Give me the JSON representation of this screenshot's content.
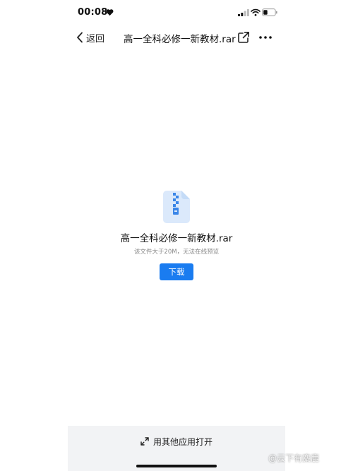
{
  "status_bar": {
    "time": "00:08",
    "icons": [
      "heart-icon",
      "signal-icon",
      "wifi-icon",
      "battery-icon"
    ]
  },
  "nav": {
    "back_label": "返回",
    "title": "高一全科必修一新教材.rar",
    "icons": [
      "chevron-left-icon",
      "share-icon",
      "more-icon"
    ]
  },
  "file": {
    "name": "高一全科必修一新教材.rar",
    "note": "该文件大于20M，无法在线预览",
    "icon": "zip-file-icon"
  },
  "actions": {
    "download_label": "下载",
    "open_with_label": "用其他应用打开",
    "open_with_icon": "expand-icon"
  },
  "watermark": "@云下有麋鹿",
  "colors": {
    "accent": "#1a7cf0",
    "file_icon_bg": "#dbe9fb",
    "file_icon_zip": "#3a86e8",
    "bottom_bar": "#f2f3f5"
  }
}
